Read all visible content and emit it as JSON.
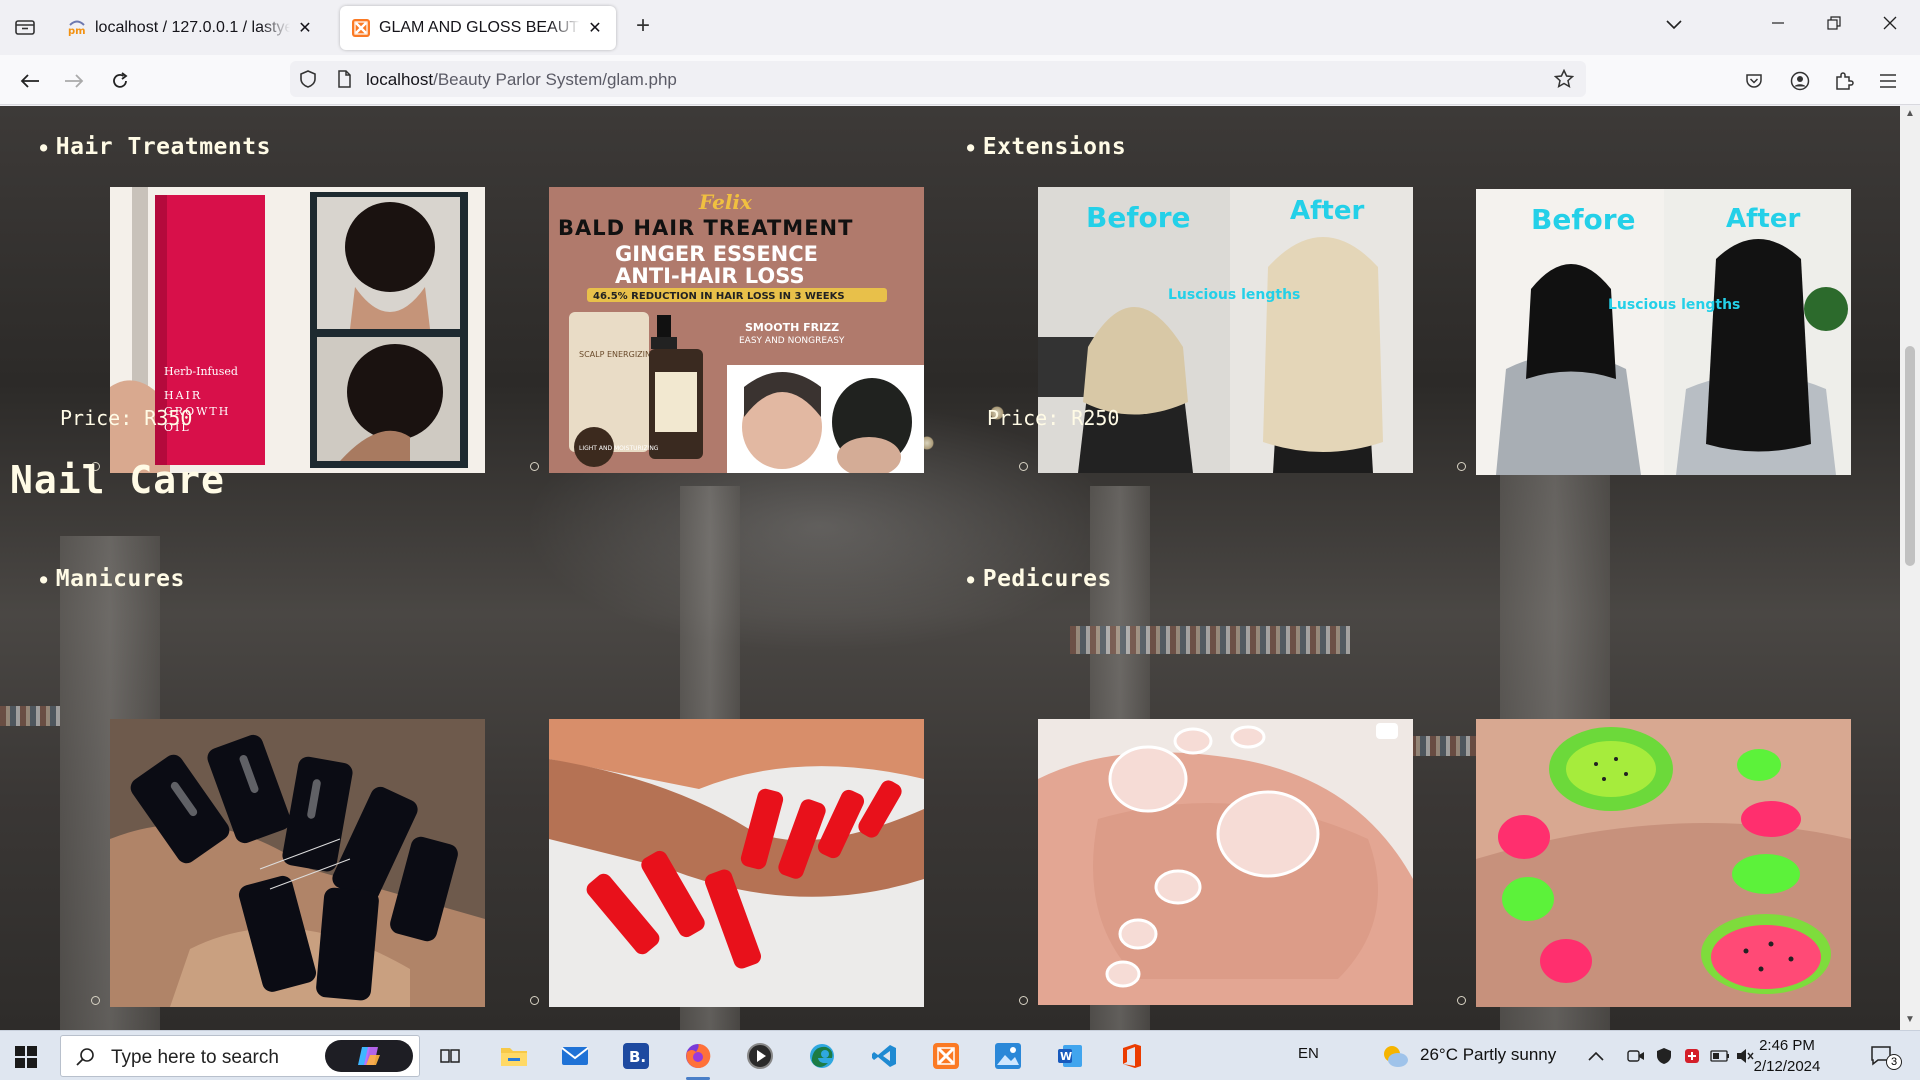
{
  "browser": {
    "tabs": [
      {
        "title": "localhost / 127.0.0.1 / lastyear /",
        "active": false
      },
      {
        "title": "GLAM AND GLOSS BEAUTY PARLOR",
        "active": true
      }
    ],
    "url": {
      "host": "localhost",
      "path": "/Beauty Parlor System/glam.php"
    }
  },
  "page": {
    "hair": {
      "treatments_heading": "Hair Treatments",
      "treatments_price": "Price: R350",
      "extensions_heading": "Extensions",
      "extensions_price": "Price: R250",
      "images": {
        "oil_label_1": "Herb-Infused",
        "oil_label_2": "HAIR",
        "oil_label_3": "GROWTH",
        "oil_label_4": "OIL",
        "bald_brand": "Felix",
        "bald_title": "BALD HAIR TREATMENT",
        "bald_sub1": "GINGER ESSENCE",
        "bald_sub2": "ANTI-HAIR LOSS",
        "bald_bar": "46.5% REDUCTION IN HAIR LOSS IN 3 WEEKS",
        "bald_frizz": "SMOOTH FRIZZ",
        "bald_grease": "EASY AND NONGREASY",
        "bald_bottle": "SCALP ENERGIZING",
        "bald_badge": "LIGHT AND MOISTURIZING",
        "before": "Before",
        "after": "After",
        "luscious": "Luscious lengths"
      }
    },
    "nail": {
      "section_heading": "Nail Care",
      "manicures_heading": "Manicures",
      "pedicures_heading": "Pedicures"
    }
  },
  "taskbar": {
    "search_placeholder": "Type here to search",
    "language": "EN",
    "weather": "26°C  Partly sunny",
    "time": "2:46 PM",
    "date": "2/12/2024",
    "notifications": "3"
  }
}
